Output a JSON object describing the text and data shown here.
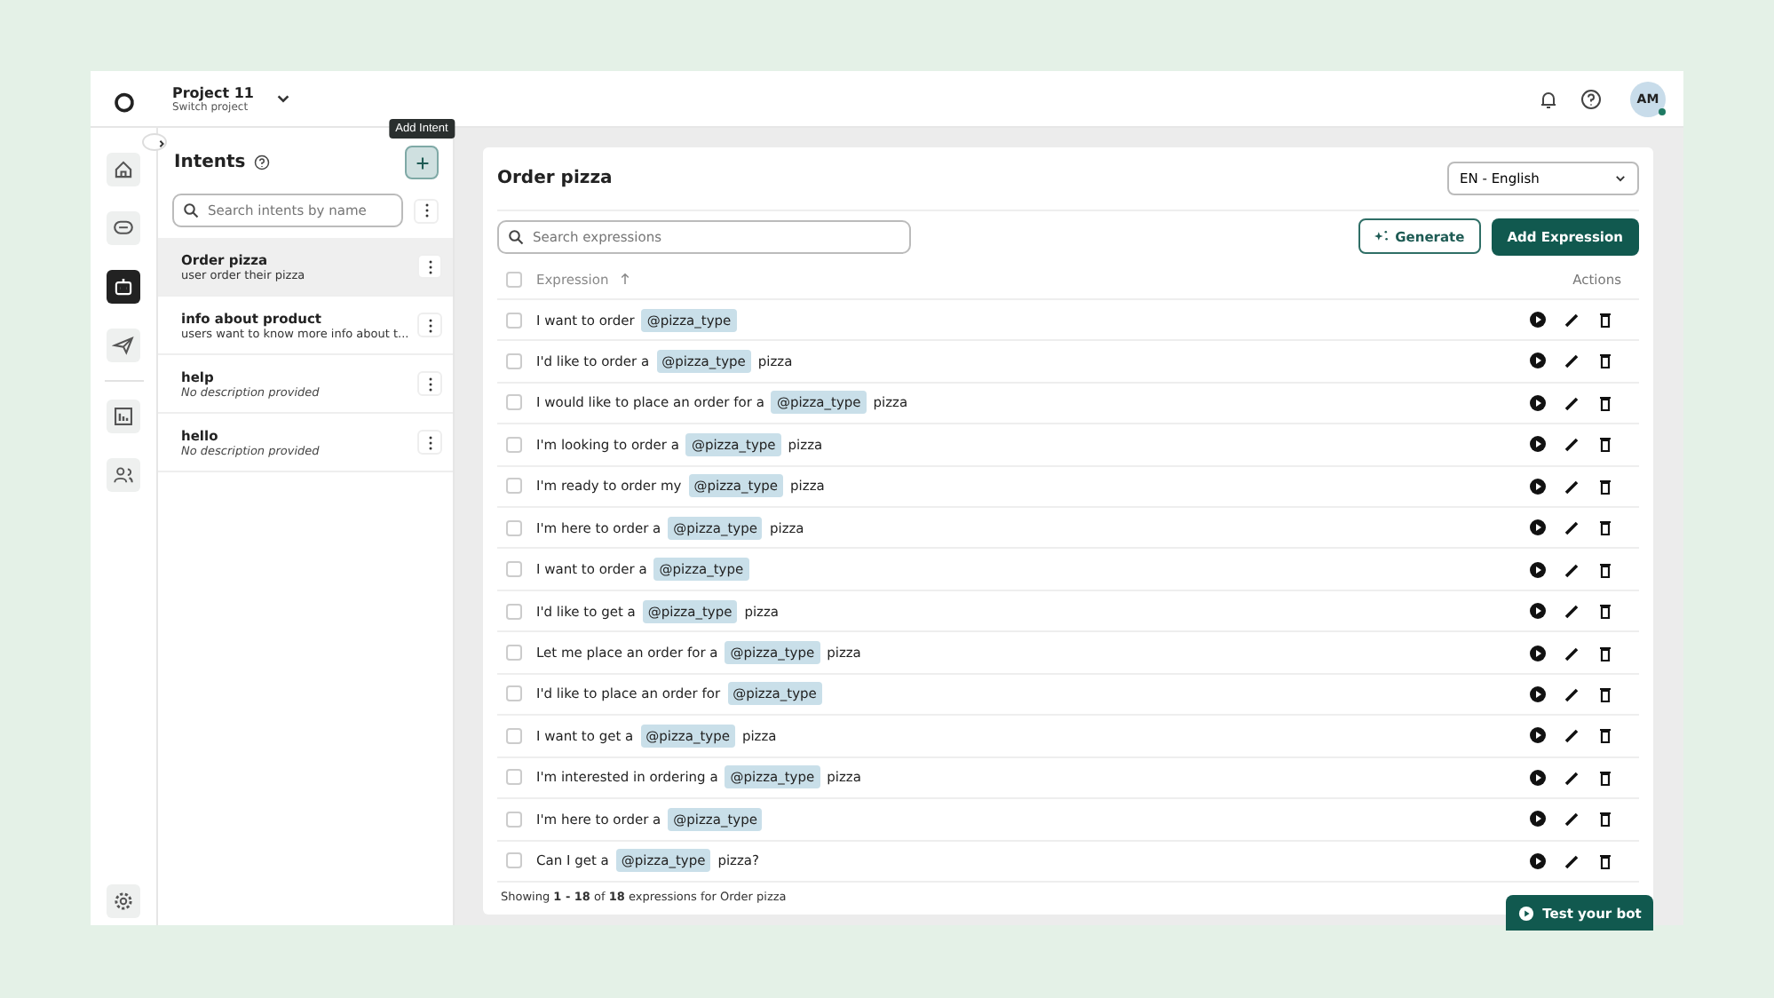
{
  "topbar": {
    "project": "Project 11",
    "subtitle": "Switch project",
    "avatar": "AM"
  },
  "rail": {
    "items": [
      {
        "selected": false
      },
      {
        "selected": false
      },
      {
        "selected": true
      },
      {
        "selected": false
      },
      {
        "selected": false
      },
      {
        "selected": false
      }
    ]
  },
  "intents": {
    "title": "Intents",
    "tooltip": "Add Intent",
    "search": {
      "placeholder": "Search intents by name"
    },
    "items": [
      {
        "name": "Order pizza",
        "description": "user order their pizza",
        "selected": true,
        "placeholder_description": false
      },
      {
        "name": "info about product",
        "description": "users want to know more info about t...",
        "selected": false,
        "placeholder_description": false
      },
      {
        "name": "help",
        "description": "No description provided",
        "selected": false,
        "placeholder_description": true
      },
      {
        "name": "hello",
        "description": "No description provided",
        "selected": false,
        "placeholder_description": true
      }
    ]
  },
  "main": {
    "title": "Order pizza",
    "language": "EN - English",
    "search": {
      "placeholder": "Search expressions"
    },
    "generate": "Generate",
    "add": "Add Expression",
    "columns": [
      "Expression",
      "Actions"
    ],
    "select_all": {
      "checked": false
    },
    "rows": [
      {
        "checked": false,
        "parts": [
          {
            "kind": "text",
            "text": "I want to order"
          },
          {
            "kind": "entity",
            "text": "@pizza_type"
          }
        ]
      },
      {
        "checked": false,
        "parts": [
          {
            "kind": "text",
            "text": "I'd like to order a"
          },
          {
            "kind": "entity",
            "text": "@pizza_type"
          },
          {
            "kind": "text",
            "text": "pizza"
          }
        ]
      },
      {
        "checked": false,
        "parts": [
          {
            "kind": "text",
            "text": "I would like to place an order for a"
          },
          {
            "kind": "entity",
            "text": "@pizza_type"
          },
          {
            "kind": "text",
            "text": "pizza"
          }
        ]
      },
      {
        "checked": false,
        "parts": [
          {
            "kind": "text",
            "text": "I'm looking to order a"
          },
          {
            "kind": "entity",
            "text": "@pizza_type"
          },
          {
            "kind": "text",
            "text": "pizza"
          }
        ]
      },
      {
        "checked": false,
        "parts": [
          {
            "kind": "text",
            "text": "I'm ready to order my"
          },
          {
            "kind": "entity",
            "text": "@pizza_type"
          },
          {
            "kind": "text",
            "text": "pizza"
          }
        ]
      },
      {
        "checked": false,
        "parts": [
          {
            "kind": "text",
            "text": "I'm here to order a"
          },
          {
            "kind": "entity",
            "text": "@pizza_type"
          },
          {
            "kind": "text",
            "text": "pizza"
          }
        ]
      },
      {
        "checked": false,
        "parts": [
          {
            "kind": "text",
            "text": "I want to order a"
          },
          {
            "kind": "entity",
            "text": "@pizza_type"
          }
        ]
      },
      {
        "checked": false,
        "parts": [
          {
            "kind": "text",
            "text": "I'd like to get a"
          },
          {
            "kind": "entity",
            "text": "@pizza_type"
          },
          {
            "kind": "text",
            "text": "pizza"
          }
        ]
      },
      {
        "checked": false,
        "parts": [
          {
            "kind": "text",
            "text": "Let me place an order for a"
          },
          {
            "kind": "entity",
            "text": "@pizza_type"
          },
          {
            "kind": "text",
            "text": "pizza"
          }
        ]
      },
      {
        "checked": false,
        "parts": [
          {
            "kind": "text",
            "text": "I'd like to place an order for"
          },
          {
            "kind": "entity",
            "text": "@pizza_type"
          }
        ]
      },
      {
        "checked": false,
        "parts": [
          {
            "kind": "text",
            "text": "I want to get a"
          },
          {
            "kind": "entity",
            "text": "@pizza_type"
          },
          {
            "kind": "text",
            "text": "pizza"
          }
        ]
      },
      {
        "checked": false,
        "parts": [
          {
            "kind": "text",
            "text": "I'm interested in ordering a"
          },
          {
            "kind": "entity",
            "text": "@pizza_type"
          },
          {
            "kind": "text",
            "text": "pizza"
          }
        ]
      },
      {
        "checked": false,
        "parts": [
          {
            "kind": "text",
            "text": "I'm here to order a"
          },
          {
            "kind": "entity",
            "text": "@pizza_type"
          }
        ]
      },
      {
        "checked": false,
        "parts": [
          {
            "kind": "text",
            "text": "Can I get a"
          },
          {
            "kind": "entity",
            "text": "@pizza_type"
          },
          {
            "kind": "text",
            "text": "pizza?"
          }
        ]
      }
    ],
    "footer": "Showing **1 - 18** of **18** expressions for Order pizza"
  },
  "test_button": "Test your bot"
}
